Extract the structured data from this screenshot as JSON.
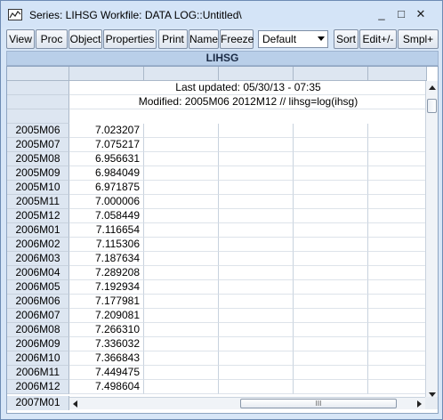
{
  "window": {
    "title": "Series: LIHSG   Workfile: DATA LOG::Untitled\\",
    "minimize": "_",
    "maximize": "□",
    "close": "✕"
  },
  "toolbar": {
    "view": "View",
    "proc": "Proc",
    "object": "Object",
    "properties": "Properties",
    "print": "Print",
    "name": "Name",
    "freeze": "Freeze",
    "format_select": "Default",
    "sort": "Sort",
    "edit": "Edit+/-",
    "smpl": "Smpl+"
  },
  "series": {
    "name": "LIHSG",
    "last_updated": "Last updated: 05/30/13 - 07:35",
    "modified": "Modified: 2005M06 2012M12 // lihsg=log(ihsg)"
  },
  "rows": [
    {
      "label": "2005M06",
      "value": "7.023207"
    },
    {
      "label": "2005M07",
      "value": "7.075217"
    },
    {
      "label": "2005M08",
      "value": "6.956631"
    },
    {
      "label": "2005M09",
      "value": "6.984049"
    },
    {
      "label": "2005M10",
      "value": "6.971875"
    },
    {
      "label": "2005M11",
      "value": "7.000006"
    },
    {
      "label": "2005M12",
      "value": "7.058449"
    },
    {
      "label": "2006M01",
      "value": "7.116654"
    },
    {
      "label": "2006M02",
      "value": "7.115306"
    },
    {
      "label": "2006M03",
      "value": "7.187634"
    },
    {
      "label": "2006M04",
      "value": "7.289208"
    },
    {
      "label": "2006M05",
      "value": "7.192934"
    },
    {
      "label": "2006M06",
      "value": "7.177981"
    },
    {
      "label": "2006M07",
      "value": "7.209081"
    },
    {
      "label": "2006M08",
      "value": "7.266310"
    },
    {
      "label": "2006M09",
      "value": "7.336032"
    },
    {
      "label": "2006M10",
      "value": "7.366843"
    },
    {
      "label": "2006M11",
      "value": "7.449475"
    },
    {
      "label": "2006M12",
      "value": "7.498604"
    }
  ],
  "last_row_label": "2007M01",
  "scroll_thumb_grip": "III"
}
